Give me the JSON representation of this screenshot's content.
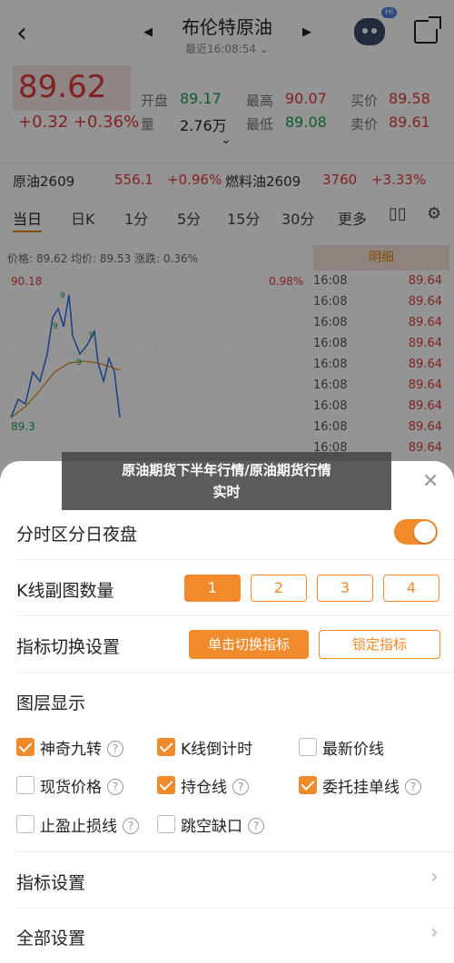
{
  "nav": {
    "title": "布伦特原油",
    "time": "最近16:08:54 ⌄",
    "bot_badge": "Hi"
  },
  "quote": {
    "price": "89.62",
    "change": "+0.32",
    "change_pct": "+0.36%",
    "open_label": "开盘",
    "open": "89.17",
    "high_label": "最高",
    "high": "90.07",
    "bid_label": "买价",
    "bid": "89.58",
    "vol_label": "量",
    "vol": "2.76万",
    "low_label": "最低",
    "low": "89.08",
    "ask_label": "卖价",
    "ask": "89.61"
  },
  "ticker": {
    "item1_name": "原油2609",
    "item1_price": "556.1",
    "item1_pct": "+0.96%",
    "item2_name": "燃料油2609",
    "item2_price": "3760",
    "item2_pct": "+3.33%"
  },
  "tabs": [
    "当日",
    "日K",
    "1分",
    "5分",
    "15分",
    "30分",
    "更多"
  ],
  "chart": {
    "header": "价格: 89.62  均价: 89.53  涨跌: 0.36%",
    "top_label": "90.18",
    "bottom_label": "89.3",
    "pct_label": "0.98%",
    "marker": "9"
  },
  "details": {
    "title": "明细",
    "rows": [
      {
        "t": "16:08",
        "v": "89.64"
      },
      {
        "t": "16:08",
        "v": "89.64"
      },
      {
        "t": "16:08",
        "v": "89.64"
      },
      {
        "t": "16:08",
        "v": "89.64"
      },
      {
        "t": "16:08",
        "v": "89.64"
      },
      {
        "t": "16:08",
        "v": "89.64"
      },
      {
        "t": "16:08",
        "v": "89.64"
      },
      {
        "t": "16:08",
        "v": "89.64"
      },
      {
        "t": "16:08",
        "v": "89.64"
      }
    ]
  },
  "caption": {
    "line1": "原油期货下半年行情/原油期货行情",
    "line2": "实时"
  },
  "sheet": {
    "close": "✕",
    "session_label": "分时区分日夜盘",
    "session_on": true,
    "kline_label": "K线副图数量",
    "kline_options": [
      "1",
      "2",
      "3",
      "4"
    ],
    "indicator_label": "指标切换设置",
    "indicator_btn1": "单击切换指标",
    "indicator_btn2": "锁定指标",
    "layer_label": "图层显示",
    "layers": [
      {
        "label": "神奇九转",
        "checked": true
      },
      {
        "label": "K线倒计时",
        "checked": true
      },
      {
        "label": "最新价线",
        "checked": false
      },
      {
        "label": "现货价格",
        "checked": false
      },
      {
        "label": "持仓线",
        "checked": true
      },
      {
        "label": "委托挂单线",
        "checked": true
      },
      {
        "label": "止盈止损线",
        "checked": false
      },
      {
        "label": "跳空缺口",
        "checked": false
      }
    ],
    "help_glyph": "?",
    "indicator_settings": "指标设置",
    "all_settings": "全部设置",
    "arrow": "›"
  }
}
